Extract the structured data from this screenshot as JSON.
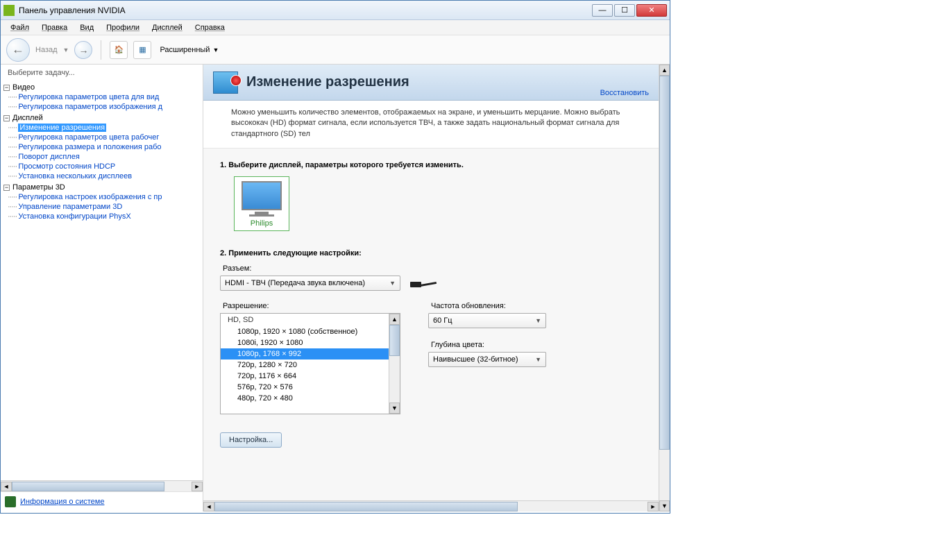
{
  "window": {
    "title": "Панель управления NVIDIA"
  },
  "menubar": {
    "items": [
      "Файл",
      "Правка",
      "Вид",
      "Профили",
      "Дисплей",
      "Справка"
    ]
  },
  "toolbar": {
    "back_label": "Назад",
    "advanced_label": "Расширенный"
  },
  "sidebar": {
    "header": "Выберите задачу...",
    "categories": [
      {
        "label": "Видео",
        "items": [
          "Регулировка параметров цвета для вид",
          "Регулировка параметров изображения д"
        ]
      },
      {
        "label": "Дисплей",
        "items": [
          "Изменение разрешения",
          "Регулировка параметров цвета рабочег",
          "Регулировка размера и положения рабо",
          "Поворот дисплея",
          "Просмотр состояния HDCP",
          "Установка нескольких дисплеев"
        ],
        "selected_index": 0
      },
      {
        "label": "Параметры 3D",
        "items": [
          "Регулировка настроек изображения с пр",
          "Управление параметрами 3D",
          "Установка конфигурации PhysX"
        ]
      }
    ],
    "footer_link": "Информация о системе"
  },
  "main": {
    "title": "Изменение разрешения",
    "restore": "Восстановить",
    "description": "Можно уменьшить количество элементов, отображаемых на экране, и уменьшить мерцание. Можно выбрать высококач (HD) формат сигнала, если используется ТВЧ, а также задать национальный формат сигнала для стандартного (SD) тел",
    "step1": "1. Выберите дисплей, параметры которого требуется изменить.",
    "display_name": "Philips",
    "step2": "2. Применить следующие настройки:",
    "connector_label": "Разъем:",
    "connector_value": "HDMI - ТВЧ (Передача звука включена)",
    "resolution_label": "Разрешение:",
    "resolution_group": "HD, SD",
    "resolutions": [
      "1080p, 1920 × 1080 (собственное)",
      "1080i, 1920 × 1080",
      "1080p, 1768 × 992",
      "720p, 1280 × 720",
      "720p, 1176 × 664",
      "576p, 720 × 576",
      "480p, 720 × 480"
    ],
    "resolution_selected_index": 2,
    "refresh_label": "Частота обновления:",
    "refresh_value": "60 Гц",
    "colordepth_label": "Глубина цвета:",
    "colordepth_value": "Наивысшее (32-битное)",
    "settings_btn": "Настройка..."
  }
}
